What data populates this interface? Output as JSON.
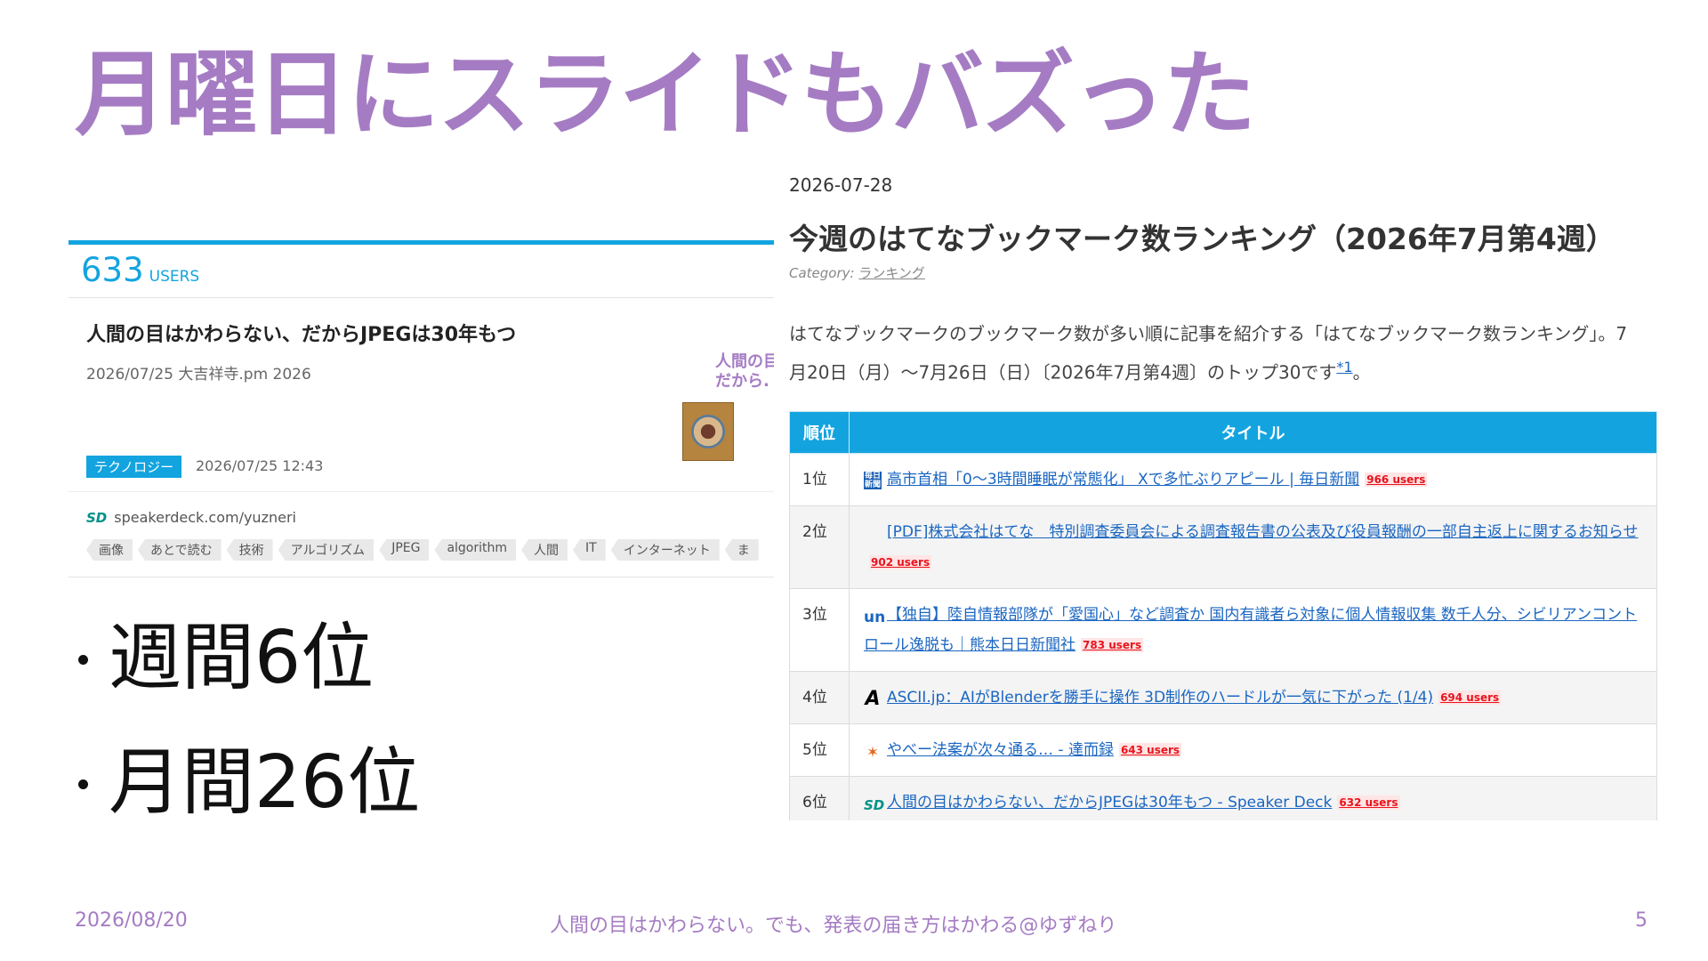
{
  "slide": {
    "title": "月曜日にスライドもバズった",
    "bullets": [
      "週間6位",
      "月間26位"
    ]
  },
  "bookmark_card": {
    "users_count": "633",
    "users_label": "USERS",
    "entry_title": "人間の目はかわらない、だからJPEGは30年もつ",
    "entry_meta": "2026/07/25 大吉祥寺.pm 2026",
    "thumbnail_text_line1": "人間の目",
    "thumbnail_text_line2": "だから.",
    "category": "テクノロジー",
    "bookmarked_at": "2026/07/25 12:43",
    "domain": "speakerdeck.com/yuzneri",
    "tags": [
      "画像",
      "あとで読む",
      "技術",
      "アルゴリズム",
      "JPEG",
      "algorithm",
      "人間",
      "IT",
      "インターネット",
      "ま"
    ]
  },
  "blog": {
    "date": "2026-07-28",
    "title": "今週のはてなブックマーク数ランキング（2026年7月第4週）",
    "category_label": "Category:",
    "category_link": "ランキング",
    "intro_text": "はてなブックマークのブックマーク数が多い順に記事を紹介する「はてなブックマーク数ランキング」。7月20日（月）～7月26日（日）〔2026年7月第4週〕のトップ30です",
    "intro_footnote": "*1",
    "intro_end": "。",
    "table_headers": {
      "rank": "順位",
      "title": "タイトル"
    },
    "rows": [
      {
        "rank": "1位",
        "icon": "mainichi-icon",
        "title": "高市首相「0～3時間睡眠が常態化」 Xで多忙ぶりアピール | 毎日新聞",
        "users": "966 users"
      },
      {
        "rank": "2位",
        "icon": "blank-icon",
        "title": "[PDF]株式会社はてな　特別調査委員会による調査報告書の公表及び役員報酬の一部自主返上に関するお知らせ",
        "users": "902 users"
      },
      {
        "rank": "3位",
        "icon": "unext-icon",
        "title": "【独自】陸自情報部隊が「愛国心」など調査か 国内有識者ら対象に個人情報収集 数千人分、シビリアンコントロール逸脱も｜熊本日日新聞社",
        "users": "783 users"
      },
      {
        "rank": "4位",
        "icon": "ascii-icon",
        "title": "ASCII.jp：AIがBlenderを勝手に操作 3D制作のハードルが一気に下がった (1/4)",
        "users": "694 users"
      },
      {
        "rank": "5位",
        "icon": "fox-icon",
        "title": "やべー法案が次々通る… - 達而録",
        "users": "643 users"
      },
      {
        "rank": "6位",
        "icon": "speakerdeck-icon",
        "title": "人間の目はかわらない、だからJPEGは30年もつ - Speaker Deck",
        "users": "632 users"
      }
    ]
  },
  "footer": {
    "date": "2026/08/20",
    "center": "人間の目はかわらない。でも、発表の届き方はかわる@ゆずねり",
    "page": "5"
  },
  "colors": {
    "accent_purple": "#a57cc3",
    "hatena_blue": "#13a4e0",
    "link_blue": "#1a66c1",
    "users_red": "#e8141e"
  }
}
